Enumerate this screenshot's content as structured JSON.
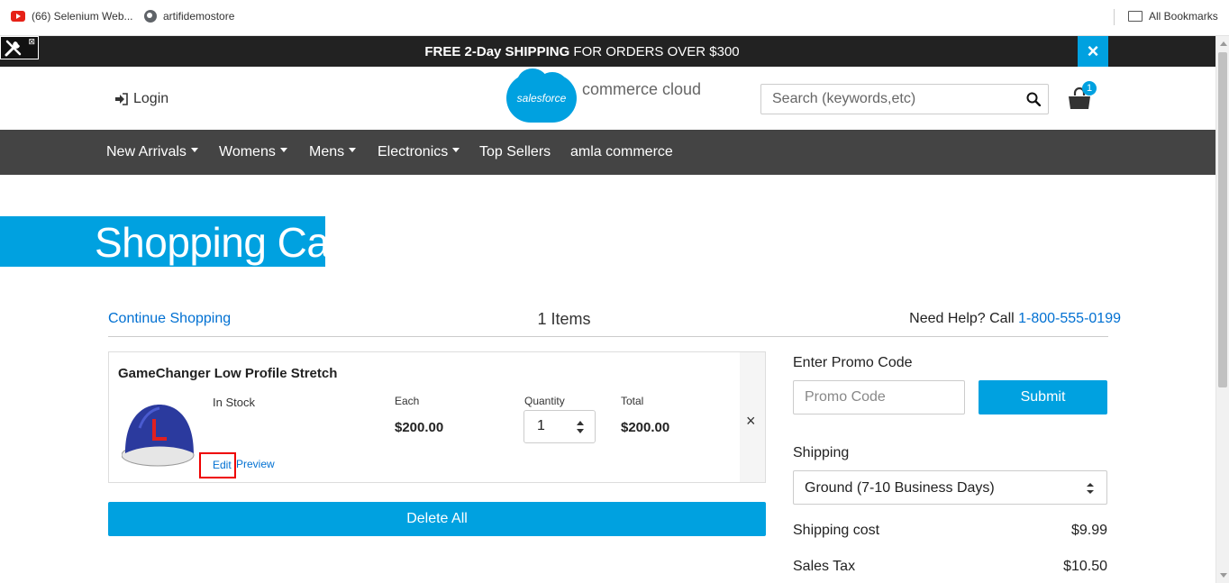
{
  "bookmarks": {
    "items": [
      {
        "label": "(66) Selenium Web...",
        "icon": "youtube-icon"
      },
      {
        "label": "artifidemostore",
        "icon": "globe-icon"
      }
    ],
    "all_label": "All Bookmarks"
  },
  "banner": {
    "bold_text": "FREE 2-Day SHIPPING",
    "text": " FOR ORDERS OVER $300",
    "close_label": "×"
  },
  "header": {
    "login_label": "Login",
    "logo_cloud_text": "salesforce",
    "logo_tagline": "commerce cloud",
    "search_placeholder": "Search (keywords,etc)",
    "cart_count": "1"
  },
  "nav": {
    "items": [
      {
        "label": "New Arrivals",
        "dropdown": true
      },
      {
        "label": "Womens",
        "dropdown": true
      },
      {
        "label": "Mens",
        "dropdown": true
      },
      {
        "label": "Electronics",
        "dropdown": true
      },
      {
        "label": "Top Sellers",
        "dropdown": false
      },
      {
        "label": "amla commerce",
        "dropdown": false
      }
    ]
  },
  "page": {
    "title": "Shopping Cart",
    "continue_label": "Continue Shopping",
    "items_count": "1 Items",
    "help_text": "Need Help? Call ",
    "help_phone": "1-800-555-0199"
  },
  "cart_item": {
    "name": "GameChanger Low Profile Stretch",
    "stock": "In Stock",
    "each_label": "Each",
    "each_value": "$200.00",
    "quantity_label": "Quantity",
    "quantity_value": "1",
    "total_label": "Total",
    "total_value": "$200.00",
    "remove_label": "×",
    "edit_label": "Edit",
    "preview_label": "Preview"
  },
  "delete_all_label": "Delete All",
  "summary": {
    "promo_label": "Enter Promo Code",
    "promo_placeholder": "Promo Code",
    "submit_label": "Submit",
    "shipping_label": "Shipping",
    "shipping_selected": "Ground (7-10 Business Days)",
    "shipping_cost_label": "Shipping cost",
    "shipping_cost_value": "$9.99",
    "sales_tax_label": "Sales Tax",
    "sales_tax_value": "$10.50"
  },
  "colors": {
    "accent": "#00a1e0",
    "link": "#0070d2",
    "nav_bg": "#444444",
    "banner_bg": "#222222",
    "highlight": "#ee0000"
  }
}
